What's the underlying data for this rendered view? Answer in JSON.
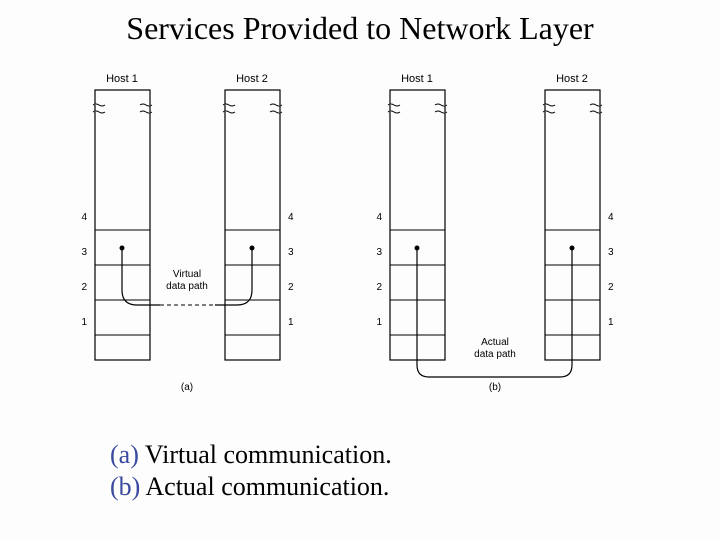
{
  "title": "Services Provided to Network Layer",
  "hosts": {
    "h1": "Host 1",
    "h2": "Host 2"
  },
  "layers": {
    "l4": "4",
    "l3": "3",
    "l2": "2",
    "l1": "1"
  },
  "path_labels": {
    "virtual_line1": "Virtual",
    "virtual_line2": "data path",
    "actual_line1": "Actual",
    "actual_line2": "data path"
  },
  "sublabels": {
    "a": "(a)",
    "b": "(b)"
  },
  "caption_a_prefix": "(a) ",
  "caption_a_text": "Virtual communication.",
  "caption_b_prefix": "(b) ",
  "caption_b_text": "Actual communication."
}
